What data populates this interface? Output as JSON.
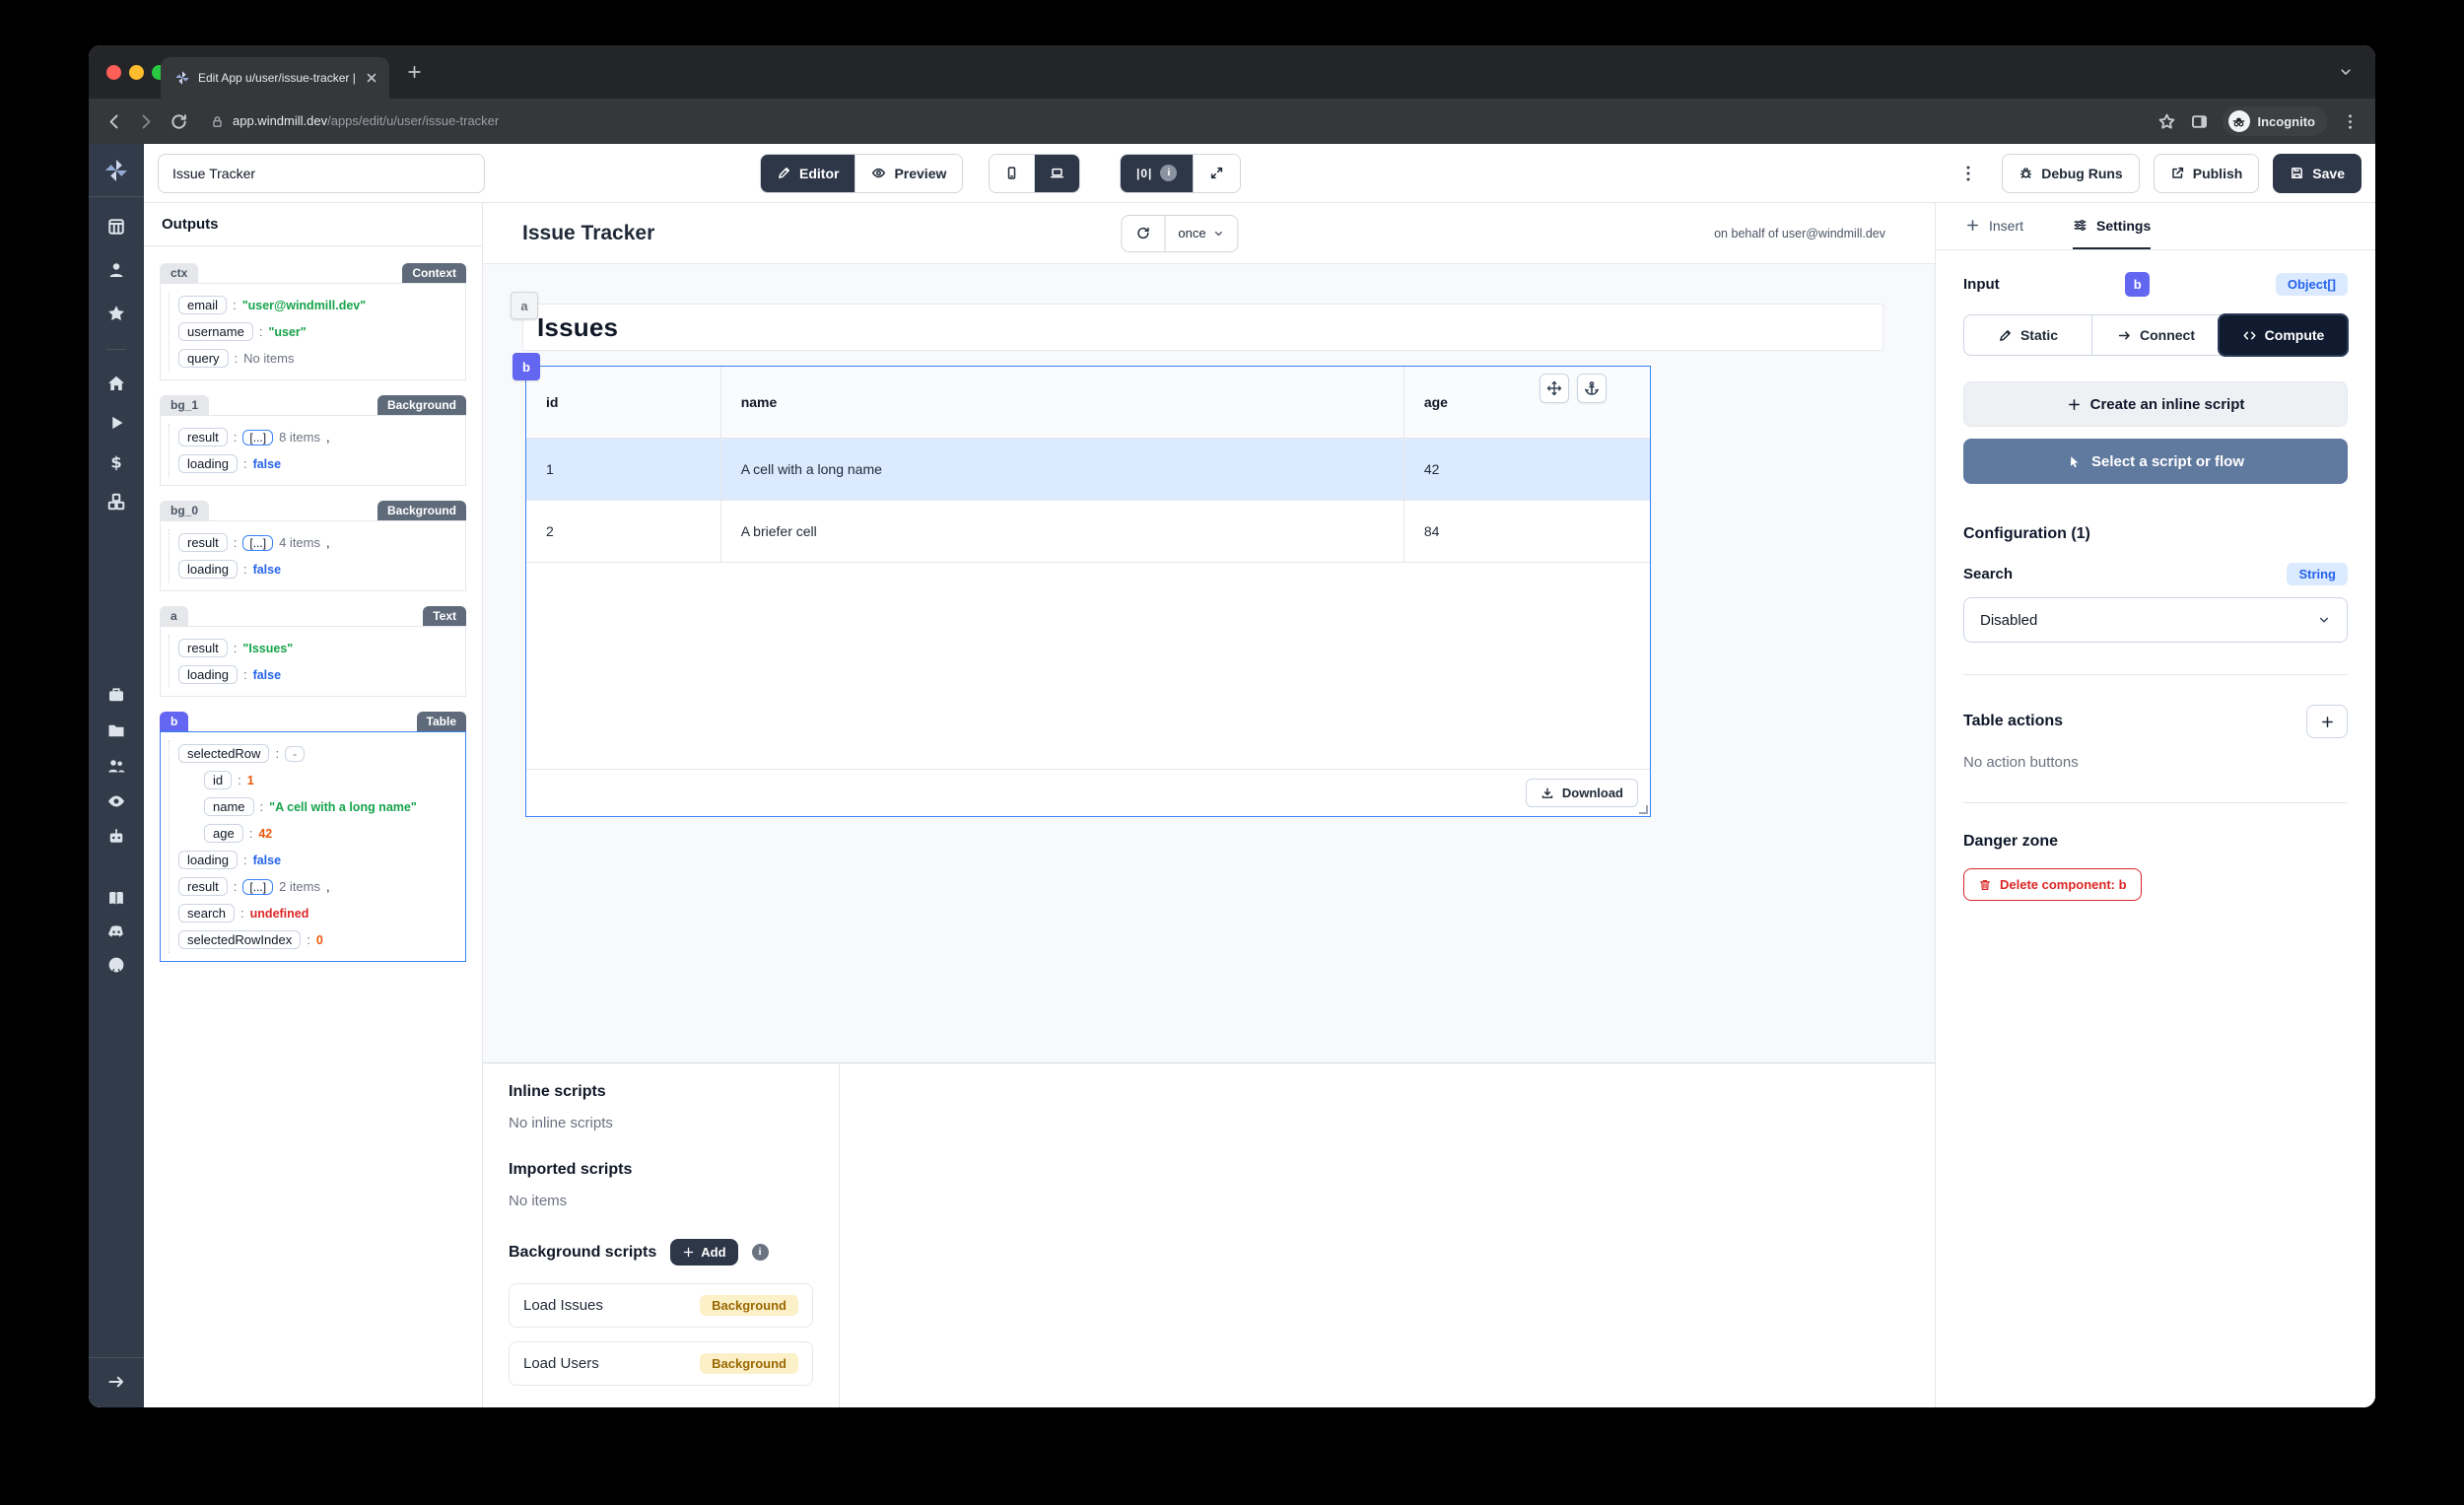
{
  "browser": {
    "tab_title": "Edit App u/user/issue-tracker |",
    "url_host": "app.windmill.dev",
    "url_path": "/apps/edit/u/user/issue-tracker",
    "incognito_label": "Incognito"
  },
  "toolbar": {
    "app_name_value": "Issue Tracker",
    "editor": "Editor",
    "preview": "Preview",
    "zero_badge": "|0|",
    "debug_runs": "Debug Runs",
    "publish": "Publish",
    "save": "Save"
  },
  "rail": {
    "groups": [
      [
        "app-grid-icon",
        "user-icon",
        "star-icon"
      ],
      [
        "home-icon",
        "play-icon",
        "dollar-icon",
        "cubes-icon"
      ],
      [
        "briefcase-icon",
        "folder-icon",
        "users-icon",
        "eye-icon",
        "robot-icon"
      ],
      [
        "book-icon",
        "discord-icon",
        "github-icon"
      ]
    ]
  },
  "outputs": {
    "title": "Outputs",
    "cards": [
      {
        "id": "ctx",
        "badge": "Context",
        "selected": false,
        "indigo": false,
        "rows": [
          {
            "key": "email",
            "type": "string",
            "value": "\"user@windmill.dev\""
          },
          {
            "key": "username",
            "type": "string",
            "value": "\"user\""
          },
          {
            "key": "query",
            "type": "muted",
            "value": "No items"
          }
        ]
      },
      {
        "id": "bg_1",
        "badge": "Background",
        "selected": false,
        "indigo": false,
        "rows": [
          {
            "key": "result",
            "type": "array",
            "value": "8 items"
          },
          {
            "key": "loading",
            "type": "bool",
            "value": "false"
          }
        ]
      },
      {
        "id": "bg_0",
        "badge": "Background",
        "selected": false,
        "indigo": false,
        "rows": [
          {
            "key": "result",
            "type": "array",
            "value": "4 items"
          },
          {
            "key": "loading",
            "type": "bool",
            "value": "false"
          }
        ]
      },
      {
        "id": "a",
        "badge": "Text",
        "selected": false,
        "indigo": false,
        "rows": [
          {
            "key": "result",
            "type": "string",
            "value": "\"Issues\""
          },
          {
            "key": "loading",
            "type": "bool",
            "value": "false"
          }
        ]
      },
      {
        "id": "b",
        "badge": "Table",
        "selected": true,
        "indigo": true,
        "rows": [
          {
            "key": "selectedRow",
            "type": "dash",
            "value": "-"
          },
          {
            "key": "id",
            "type": "number",
            "value": "1",
            "indent": true
          },
          {
            "key": "name",
            "type": "string",
            "value": "\"A cell with a long name\"",
            "indent": true
          },
          {
            "key": "age",
            "type": "number",
            "value": "42",
            "indent": true
          },
          {
            "key": "loading",
            "type": "bool",
            "value": "false"
          },
          {
            "key": "result",
            "type": "array",
            "value": "2 items"
          },
          {
            "key": "search",
            "type": "undef",
            "value": "undefined"
          },
          {
            "key": "selectedRowIndex",
            "type": "number",
            "value": "0"
          }
        ]
      }
    ]
  },
  "canvas": {
    "header_title": "Issue Tracker",
    "refresh_mode": "once",
    "on_behalf": "on behalf of user@windmill.dev",
    "heading_component": {
      "id": "a",
      "text": "Issues"
    },
    "table_component": {
      "id": "b",
      "columns": [
        "id",
        "name",
        "age"
      ],
      "rows": [
        [
          "1",
          "A cell with a long name",
          "42"
        ],
        [
          "2",
          "A briefer cell",
          "84"
        ]
      ],
      "selected_row_index": 0,
      "download_label": "Download"
    }
  },
  "scripts_panel": {
    "inline_title": "Inline scripts",
    "inline_empty": "No inline scripts",
    "imported_title": "Imported scripts",
    "imported_empty": "No items",
    "background_title": "Background scripts",
    "add_label": "Add",
    "items": [
      {
        "name": "Load Issues",
        "badge": "Background"
      },
      {
        "name": "Load Users",
        "badge": "Background"
      }
    ]
  },
  "settings": {
    "tabs": [
      {
        "label": "Insert"
      },
      {
        "label": "Settings"
      }
    ],
    "input_label": "Input",
    "component_id": "b",
    "type_badge": "Object[]",
    "modes": [
      {
        "label": "Static"
      },
      {
        "label": "Connect"
      },
      {
        "label": "Compute"
      }
    ],
    "create_inline": "Create an inline script",
    "select_script": "Select a script or flow",
    "configuration_title": "Configuration (1)",
    "search_label": "Search",
    "search_type": "String",
    "search_value": "Disabled",
    "table_actions_title": "Table actions",
    "table_actions_empty": "No action buttons",
    "danger_title": "Danger zone",
    "delete_label": "Delete component: b"
  },
  "colors": {
    "accent_indigo": "#6366f1",
    "selection_blue": "#3b82f6",
    "selected_row_bg": "#dbeafe",
    "dark_button": "#2d3748",
    "steel_button": "#60799e",
    "danger_red": "#dc2626",
    "string_green": "#16a34a",
    "bool_blue": "#2563eb",
    "number_orange": "#ea580c",
    "badge_yellow_bg": "#fbf0c8",
    "badge_yellow_text": "#9a6700"
  }
}
